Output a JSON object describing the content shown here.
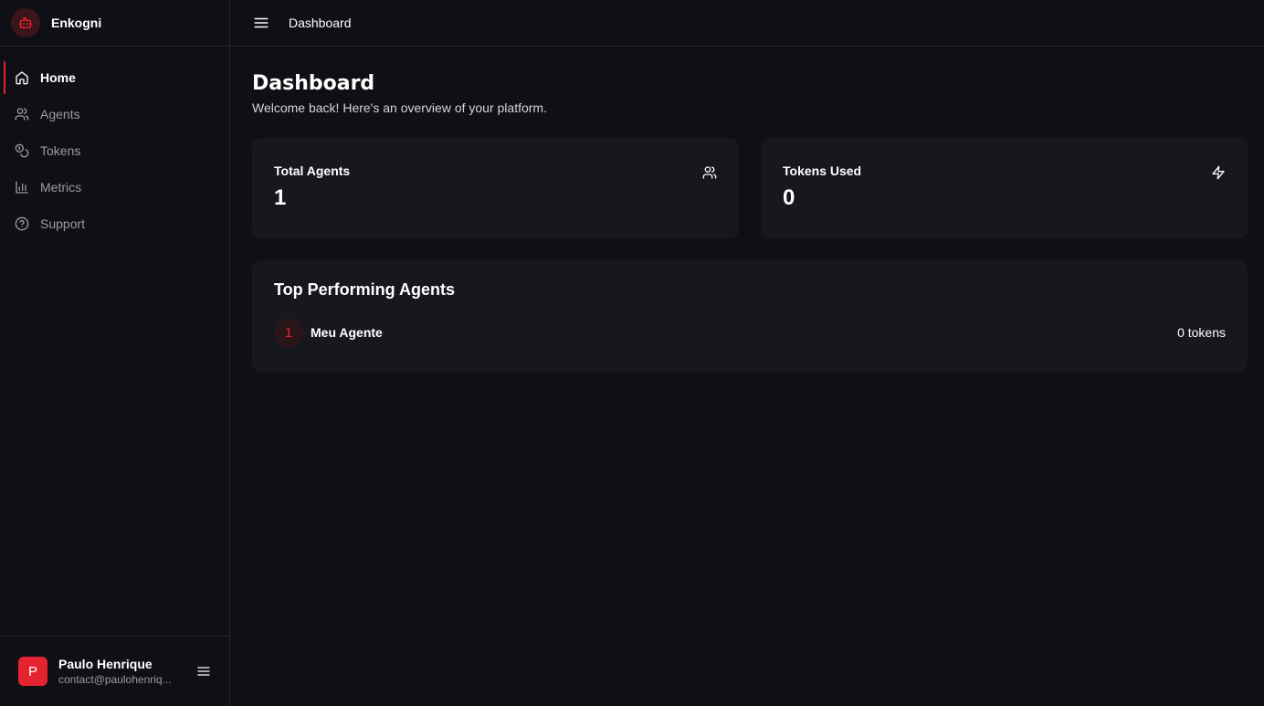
{
  "brand": {
    "name": "Enkogni",
    "icon": "robot-icon"
  },
  "colors": {
    "accent": "#e5232f",
    "background": "#0f1015",
    "card": "#17181e"
  },
  "sidebar": {
    "items": [
      {
        "label": "Home",
        "icon": "home-icon",
        "active": true
      },
      {
        "label": "Agents",
        "icon": "users-icon",
        "active": false
      },
      {
        "label": "Tokens",
        "icon": "coins-icon",
        "active": false
      },
      {
        "label": "Metrics",
        "icon": "bar-chart-icon",
        "active": false
      },
      {
        "label": "Support",
        "icon": "help-circle-icon",
        "active": false
      }
    ]
  },
  "user": {
    "initial": "P",
    "name": "Paulo Henrique",
    "email": "contact@paulohenriq..."
  },
  "topbar": {
    "title": "Dashboard"
  },
  "page": {
    "title": "Dashboard",
    "subtitle": "Welcome back! Here's an overview of your platform."
  },
  "stats": [
    {
      "label": "Total Agents",
      "value": "1",
      "icon": "users-icon"
    },
    {
      "label": "Tokens Used",
      "value": "0",
      "icon": "zap-icon"
    }
  ],
  "top_agents": {
    "title": "Top Performing Agents",
    "rows": [
      {
        "rank": "1",
        "name": "Meu Agente",
        "tokens": "0 tokens"
      }
    ]
  }
}
